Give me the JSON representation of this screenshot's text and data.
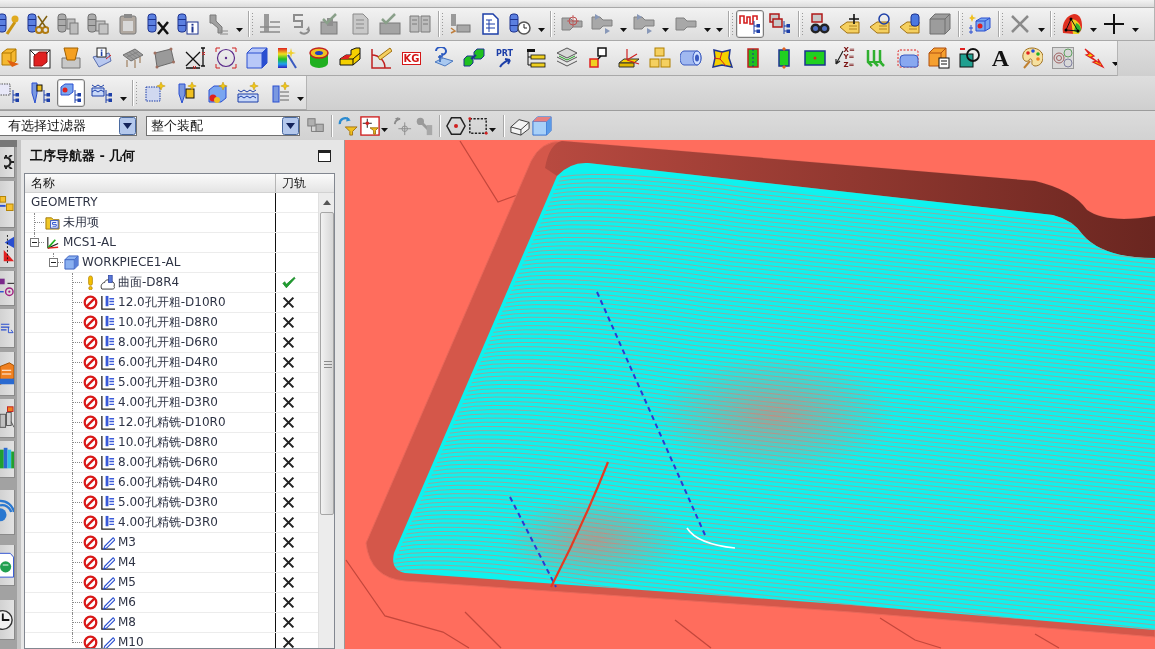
{
  "toolbar": {
    "toggles": [
      {
        "selected": true
      },
      {
        "selected": false
      }
    ],
    "labels": [
      {
        "text": "KG",
        "kind": "boxed"
      },
      {
        "text": "PRT",
        "kind": "arrow"
      },
      {
        "text": "X= Y= Z=",
        "kind": "stacked"
      },
      {
        "text": "A",
        "kind": "serif"
      }
    ],
    "views": [
      {
        "selected": false
      },
      {
        "selected": false
      },
      {
        "selected": true
      },
      {
        "selected": false
      }
    ]
  },
  "filter_bar": {
    "selection_filter": "有选择过滤器",
    "assembly_scope": "整个装配"
  },
  "navigator": {
    "title": "工序导航器 - 几何",
    "columns": [
      "名称",
      "刀轨"
    ],
    "tree": [
      {
        "name": "GEOMETRY",
        "children": [
          {
            "name": "未用项",
            "kind": "unused"
          },
          {
            "name": "MCS1-AL",
            "kind": "mcs",
            "expanded": true,
            "children": [
              {
                "name": "WORKPIECE1-AL",
                "kind": "workpiece",
                "expanded": true,
                "children": [
                  {
                    "name": "曲面-D8R4",
                    "kind": "surface",
                    "regenerate": false,
                    "toolpath_generated": true
                  },
                  {
                    "name": "12.0孔开粗-D10R0",
                    "kind": "hole",
                    "regenerate": true,
                    "toolpath_generated": false
                  },
                  {
                    "name": "10.0孔开粗-D8R0",
                    "kind": "hole",
                    "regenerate": true,
                    "toolpath_generated": false
                  },
                  {
                    "name": "8.00孔开粗-D6R0",
                    "kind": "hole",
                    "regenerate": true,
                    "toolpath_generated": false
                  },
                  {
                    "name": "6.00孔开粗-D4R0",
                    "kind": "hole",
                    "regenerate": true,
                    "toolpath_generated": false
                  },
                  {
                    "name": "5.00孔开粗-D3R0",
                    "kind": "hole",
                    "regenerate": true,
                    "toolpath_generated": false
                  },
                  {
                    "name": "4.00孔开粗-D3R0",
                    "kind": "hole",
                    "regenerate": true,
                    "toolpath_generated": false
                  },
                  {
                    "name": "12.0孔精铣-D10R0",
                    "kind": "hole",
                    "regenerate": true,
                    "toolpath_generated": false
                  },
                  {
                    "name": "10.0孔精铣-D8R0",
                    "kind": "hole",
                    "regenerate": true,
                    "toolpath_generated": false
                  },
                  {
                    "name": "8.00孔精铣-D6R0",
                    "kind": "hole",
                    "regenerate": true,
                    "toolpath_generated": false
                  },
                  {
                    "name": "6.00孔精铣-D4R0",
                    "kind": "hole",
                    "regenerate": true,
                    "toolpath_generated": false
                  },
                  {
                    "name": "5.00孔精铣-D3R0",
                    "kind": "hole",
                    "regenerate": true,
                    "toolpath_generated": false
                  },
                  {
                    "name": "4.00孔精铣-D3R0",
                    "kind": "hole",
                    "regenerate": true,
                    "toolpath_generated": false
                  },
                  {
                    "name": "M3",
                    "kind": "thread",
                    "regenerate": true,
                    "toolpath_generated": false
                  },
                  {
                    "name": "M4",
                    "kind": "thread",
                    "regenerate": true,
                    "toolpath_generated": false
                  },
                  {
                    "name": "M5",
                    "kind": "thread",
                    "regenerate": true,
                    "toolpath_generated": false
                  },
                  {
                    "name": "M6",
                    "kind": "thread",
                    "regenerate": true,
                    "toolpath_generated": false
                  },
                  {
                    "name": "M8",
                    "kind": "thread",
                    "regenerate": true,
                    "toolpath_generated": false
                  },
                  {
                    "name": "M10",
                    "kind": "thread",
                    "regenerate": true,
                    "toolpath_generated": false
                  }
                ]
              }
            ]
          }
        ]
      }
    ]
  }
}
